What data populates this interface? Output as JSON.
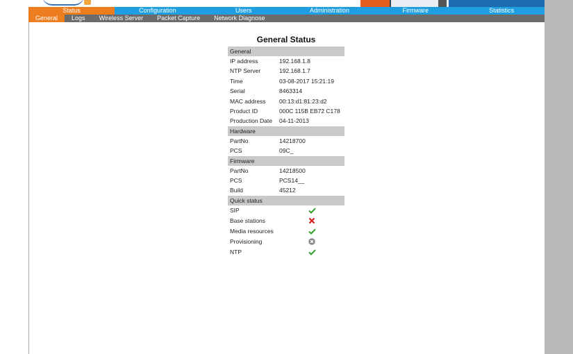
{
  "nav": {
    "tabs": [
      "Status",
      "Configuration",
      "Users",
      "Administration",
      "Firmware",
      "Statistics"
    ],
    "active": "Status"
  },
  "subnav": {
    "tabs": [
      "General",
      "Logs",
      "Wireless Server",
      "Packet Capture",
      "Network Diagnose"
    ],
    "active": "General"
  },
  "page": {
    "title": "General Status"
  },
  "general": {
    "header": "General",
    "rows": [
      {
        "label": "IP address",
        "value": "192.168.1.8"
      },
      {
        "label": "NTP Server",
        "value": "192.168.1.7"
      },
      {
        "label": "Time",
        "value": "03-08-2017 15:21:19"
      },
      {
        "label": "Serial",
        "value": "8463314"
      },
      {
        "label": "MAC address",
        "value": "00:13:d1:81:23:d2"
      },
      {
        "label": "Product ID",
        "value": "000C 115B EB72 C178"
      },
      {
        "label": "Production Date",
        "value": "04-11-2013"
      }
    ]
  },
  "hardware": {
    "header": "Hardware",
    "rows": [
      {
        "label": "PartNo",
        "value": "14218700"
      },
      {
        "label": "PCS",
        "value": "09C_"
      }
    ]
  },
  "firmware": {
    "header": "Firmware",
    "rows": [
      {
        "label": "PartNo",
        "value": "14218500"
      },
      {
        "label": "PCS",
        "value": "PCS14__"
      },
      {
        "label": "Build",
        "value": "45212"
      }
    ]
  },
  "quick_status": {
    "header": "Quick status",
    "rows": [
      {
        "label": "SIP",
        "status": "ok",
        "icon": "check-icon"
      },
      {
        "label": "Base stations",
        "status": "error",
        "icon": "cross-icon"
      },
      {
        "label": "Media resources",
        "status": "ok",
        "icon": "check-icon"
      },
      {
        "label": "Provisioning",
        "status": "disabled",
        "icon": "gray-x-circle-icon"
      },
      {
        "label": "NTP",
        "status": "ok",
        "icon": "check-icon"
      }
    ]
  },
  "colors": {
    "nav_blue": "#1f9fe0",
    "active_orange": "#ee7d1f",
    "subnav_gray": "#6b6b6b",
    "section_gray": "#c9c9c9",
    "ok_green": "#2ea02e",
    "error_red": "#d11f1f",
    "disabled_gray": "#8a8a8a"
  }
}
